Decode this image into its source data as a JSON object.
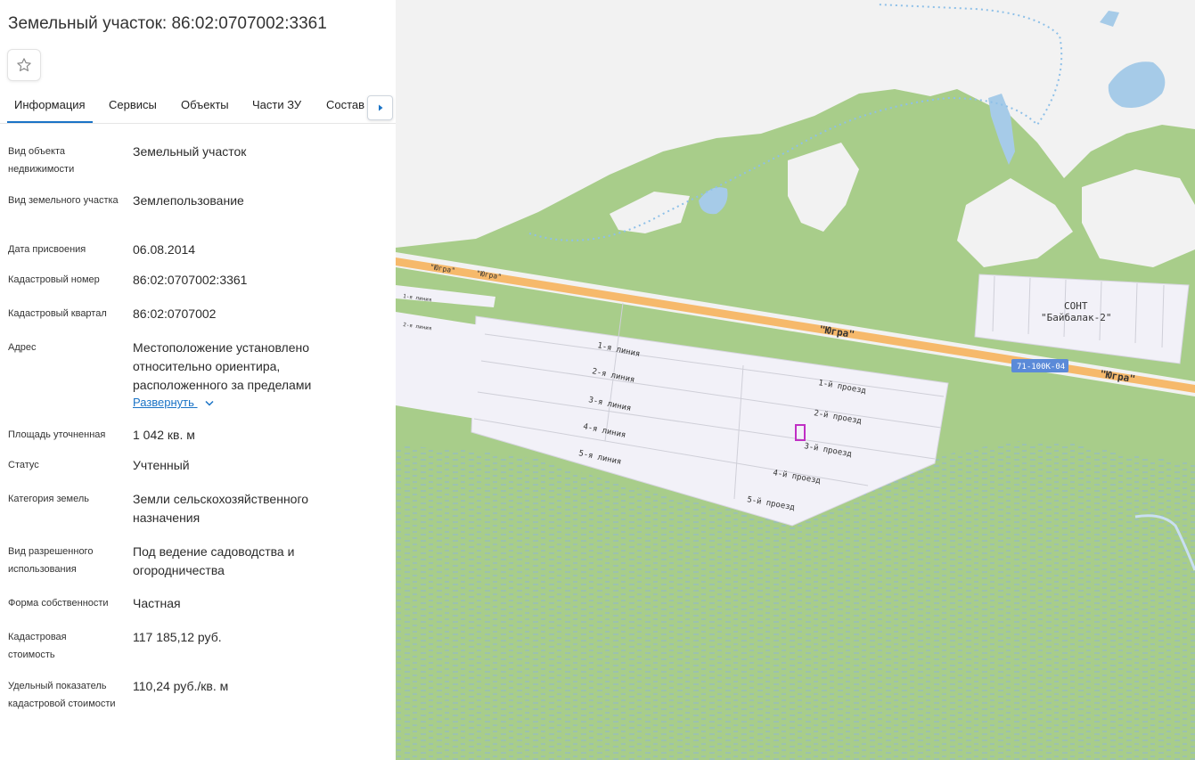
{
  "header": {
    "title": "Земельный участок: 86:02:0707002:3361"
  },
  "tabs": [
    {
      "label": "Информация"
    },
    {
      "label": "Сервисы"
    },
    {
      "label": "Объекты"
    },
    {
      "label": "Части ЗУ"
    },
    {
      "label": "Состав"
    }
  ],
  "info": [
    {
      "label": "Вид объекта недвижимости",
      "value": "Земельный участок"
    },
    {
      "label": "Вид земельного участка",
      "value": "Землепользование"
    },
    {
      "label": "Дата присвоения",
      "value": "06.08.2014"
    },
    {
      "label": "Кадастровый номер",
      "value": "86:02:0707002:3361"
    },
    {
      "label": "Кадастровый квартал",
      "value": "86:02:0707002"
    },
    {
      "label": "Адрес",
      "value": "Местоположение установлено относительно ориентира, расположенного за пределами",
      "expand": "Развернуть"
    },
    {
      "label": "Площадь уточненная",
      "value": "1 042 кв. м"
    },
    {
      "label": "Статус",
      "value": "Учтенный"
    },
    {
      "label": "Категория земель",
      "value": "Земли сельскохозяйственного назначения"
    },
    {
      "label": "Вид разрешенного использования",
      "value": "Под ведение садоводства и огородничества"
    },
    {
      "label": "Форма собственности",
      "value": "Частная"
    },
    {
      "label": "Кадастровая стоимость",
      "value": "117 185,12 руб."
    },
    {
      "label": "Удельный показатель кадастровой стоимости",
      "value": "110,24 руб./кв. м"
    }
  ],
  "map": {
    "road_name_small": "\"Югра\"",
    "road_name": "\"Югра\"",
    "road_badge": "71-100К-04",
    "snt_line1": "СОНТ",
    "snt_line2": "\"Байбалак-2\"",
    "lines": [
      "1-я линия",
      "2-я линия",
      "3-я линия",
      "4-я линия",
      "5-я линия"
    ],
    "passages": [
      "1-й проезд",
      "2-й проезд",
      "3-й проезд",
      "4-й проезд",
      "5-й проезд"
    ],
    "small_lines": [
      "1-я линия",
      "2-я линия"
    ],
    "colors": {
      "land": "#f2f2f2",
      "forest": "#a8cd8a",
      "water": "#a6cbe8",
      "road": "#f6b96b",
      "plots": "#f2f1f8",
      "parcel": "#c02fc4",
      "badge": "#5b8ad8"
    }
  }
}
